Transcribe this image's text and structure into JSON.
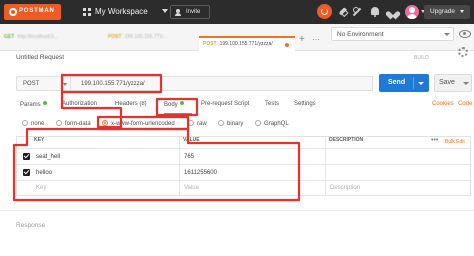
{
  "header": {
    "logo_text": "POSTMAN",
    "workspace_label": "My Workspace",
    "invite_label": "Invite",
    "upgrade_label": "Upgrade",
    "brand_color": "#ef5b25"
  },
  "tabs": [
    {
      "method": "GET",
      "label": "http://localhost:3..."
    },
    {
      "method": "POST",
      "label": "199.100.155.771/..."
    },
    {
      "method": "POST",
      "label": "199.100.155.771/yzzza/"
    }
  ],
  "environment": {
    "selected": "No Environment"
  },
  "request": {
    "title": "Untitled Request",
    "build_label": "BUILD",
    "method": "POST",
    "url": "199.100.155.771/yzzza/",
    "send_label": "Send",
    "save_label": "Save"
  },
  "subtabs": {
    "params": "Params",
    "authorization": "Authorization",
    "headers": "Headers (8)",
    "body": "Body",
    "prerequest": "Pre-request Script",
    "tests": "Tests",
    "settings": "Settings",
    "cookies": "Cookies",
    "code": "Code"
  },
  "body_types": {
    "none": "none",
    "form_data": "form-data",
    "urlencoded": "x-www-form-urlencoded",
    "raw": "raw",
    "binary": "binary",
    "graphql": "GraphQL",
    "selected": "x-www-form-urlencoded"
  },
  "table": {
    "headers": {
      "key": "KEY",
      "value": "VALUE",
      "description": "DESCRIPTION"
    },
    "more": "•••",
    "bulk_edit": "Bulk Edit",
    "rows": [
      {
        "key": "seat_hell",
        "value": "765",
        "description": ""
      },
      {
        "key": "helloo",
        "value": "1611255600",
        "description": ""
      }
    ],
    "placeholders": {
      "key": "Key",
      "value": "Value",
      "description": "Description"
    }
  },
  "response": {
    "label": "Response"
  },
  "colors": {
    "accent": "#f47023",
    "send": "#1f7ad6",
    "annotation": "#e5322d"
  }
}
